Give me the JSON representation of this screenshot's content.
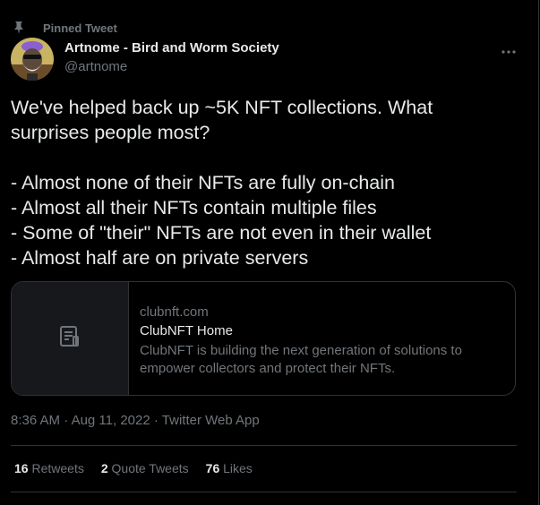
{
  "pinned": {
    "label": "Pinned Tweet"
  },
  "author": {
    "name": "Artnome - Bird and Worm Society",
    "handle": "@artnome"
  },
  "tweet": {
    "lines": [
      "We've helped back up ~5K NFT collections. What",
      "surprises people most?",
      "",
      "- Almost none of their NFTs are fully on-chain",
      "- Almost all their NFTs contain multiple files",
      "- Some of \"their\" NFTs are not even in their wallet",
      "- Almost half are on private servers"
    ]
  },
  "card": {
    "domain": "clubnft.com",
    "title": "ClubNFT Home",
    "description_lines": [
      "ClubNFT is building the next generation of solutions to",
      "empower collectors and protect their NFTs."
    ],
    "thumb_icon": "document-icon"
  },
  "meta": {
    "time": "8:36 AM",
    "separator": "·",
    "date": "Aug 11, 2022",
    "client": "Twitter Web App"
  },
  "stats": {
    "retweets_count": "16",
    "retweets_label": "Retweets",
    "quotes_count": "2",
    "quotes_label": "Quote Tweets",
    "likes_count": "76",
    "likes_label": "Likes"
  },
  "colors": {
    "background": "#000000",
    "text_primary": "#e7e9ea",
    "text_secondary": "#71767b",
    "border": "#2f3336"
  }
}
